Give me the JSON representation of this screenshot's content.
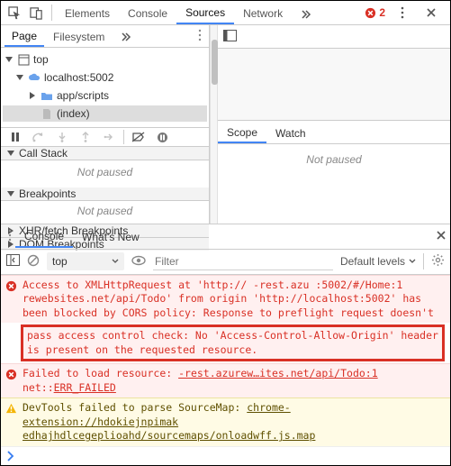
{
  "header": {
    "tabs": {
      "elements": "Elements",
      "console": "Console",
      "sources": "Sources",
      "network": "Network"
    },
    "error_count": "2"
  },
  "sources": {
    "subtabs": {
      "page": "Page",
      "filesystem": "Filesystem"
    },
    "tree": {
      "top": "top",
      "host": "localhost:5002",
      "folder": "app/scripts",
      "file": "(index)"
    },
    "sections": {
      "callstack": "Call Stack",
      "breakpoints": "Breakpoints",
      "xhr_bp": "XHR/fetch Breakpoints",
      "dom_bp": "DOM Breakpoints",
      "not_paused": "Not paused"
    },
    "scopebar": {
      "scope": "Scope",
      "watch": "Watch",
      "not_paused": "Not paused"
    }
  },
  "drawer": {
    "tabs": {
      "console": "Console",
      "whatsnew": "What's New"
    },
    "toolbar": {
      "context": "top",
      "filter_placeholder": "Filter",
      "levels": "Default levels"
    },
    "messages": {
      "m1": "Access to XMLHttpRequest at 'http://      -rest.azu :5002/#/Home:1 rewebsites.net/api/Todo' from origin 'http://localhost:5002' has been blocked by CORS policy: Response to preflight request doesn't",
      "m1_highlight": "pass access control check: No 'Access-Control-Allow-Origin' header is present on the requested resource.",
      "m2_a": "Failed to load resource:         ",
      "m2_b": "-rest.azurew…ites.net/api/Todo:1",
      "m2_c": "net::",
      "m2_d": "ERR_FAILED",
      "m3_a": "DevTools failed to parse SourceMap: ",
      "m3_b": "chrome-extension://hdokiejnpimak edhajhdlcegeplioahd/sourcemaps/onloadwff.js.map"
    }
  }
}
